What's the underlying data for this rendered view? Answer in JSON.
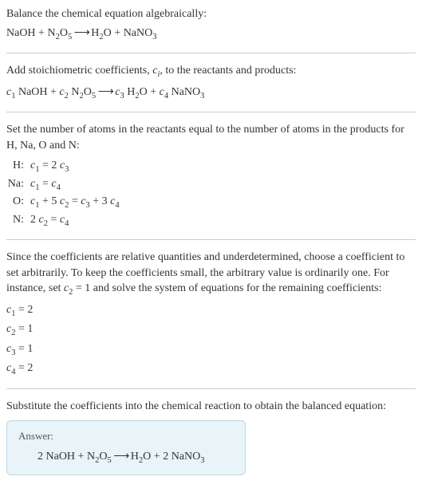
{
  "intro": {
    "line1": "Balance the chemical equation algebraically:",
    "eq_lhs1": "NaOH",
    "plus": " + ",
    "eq_lhs2_base": "N",
    "eq_lhs2_sub1": "2",
    "eq_lhs2_o": "O",
    "eq_lhs2_sub2": "5",
    "arrow": " ⟶ ",
    "eq_rhs1_h": "H",
    "eq_rhs1_sub": "2",
    "eq_rhs1_o": "O",
    "eq_rhs2_base": "NaNO",
    "eq_rhs2_sub": "3"
  },
  "step1": {
    "text_a": "Add stoichiometric coefficients, ",
    "ci": "c",
    "ci_sub": "i",
    "text_b": ", to the reactants and products:",
    "c1": "c",
    "s1": "1",
    "sp": " ",
    "naoh": "NaOH",
    "plus": " + ",
    "c2": "c",
    "s2": "2",
    "n": "N",
    "n2": "2",
    "o": "O",
    "o5": "5",
    "arrow": " ⟶ ",
    "c3": "c",
    "s3": "3",
    "h": "H",
    "h2": "2",
    "c4": "c",
    "s4": "4",
    "nano": "NaNO",
    "nano3": "3"
  },
  "step2": {
    "text": "Set the number of atoms in the reactants equal to the number of atoms in the products for H, Na, O and N:",
    "rows": [
      {
        "label": "H:",
        "c_a": "c",
        "sub_a": "1",
        "mid": " = 2 ",
        "c_b": "c",
        "sub_b": "3",
        "tail": ""
      },
      {
        "label": "Na:",
        "c_a": "c",
        "sub_a": "1",
        "mid": " = ",
        "c_b": "c",
        "sub_b": "4",
        "tail": ""
      },
      {
        "label": "O:",
        "c_a": "c",
        "sub_a": "1",
        "mid": " + 5 ",
        "c_b": "c",
        "sub_b": "2",
        "tail_a": " = ",
        "c_c": "c",
        "sub_c": "3",
        "tail_b": " + 3 ",
        "c_d": "c",
        "sub_d": "4"
      },
      {
        "label": "N:",
        "pre": "2 ",
        "c_a": "c",
        "sub_a": "2",
        "mid": " = ",
        "c_b": "c",
        "sub_b": "4",
        "tail": ""
      }
    ]
  },
  "step3": {
    "text_a": "Since the coefficients are relative quantities and underdetermined, choose a coefficient to set arbitrarily. To keep the coefficients small, the arbitrary value is ordinarily one. For instance, set ",
    "c2": "c",
    "c2sub": "2",
    "text_b": " = 1 and solve the system of equations for the remaining coefficients:",
    "coefs": [
      {
        "c": "c",
        "sub": "1",
        "val": " = 2"
      },
      {
        "c": "c",
        "sub": "2",
        "val": " = 1"
      },
      {
        "c": "c",
        "sub": "3",
        "val": " = 1"
      },
      {
        "c": "c",
        "sub": "4",
        "val": " = 2"
      }
    ]
  },
  "step4": {
    "text": "Substitute the coefficients into the chemical reaction to obtain the balanced equation:"
  },
  "answer": {
    "label": "Answer:",
    "two_a": "2 ",
    "naoh": "NaOH",
    "plus": " + ",
    "n": "N",
    "n2": "2",
    "o": "O",
    "o5": "5",
    "arrow": " ⟶ ",
    "h": "H",
    "h2": "2",
    "plus2": " + ",
    "two_b": "2 ",
    "nano": "NaNO",
    "nano3": "3"
  }
}
